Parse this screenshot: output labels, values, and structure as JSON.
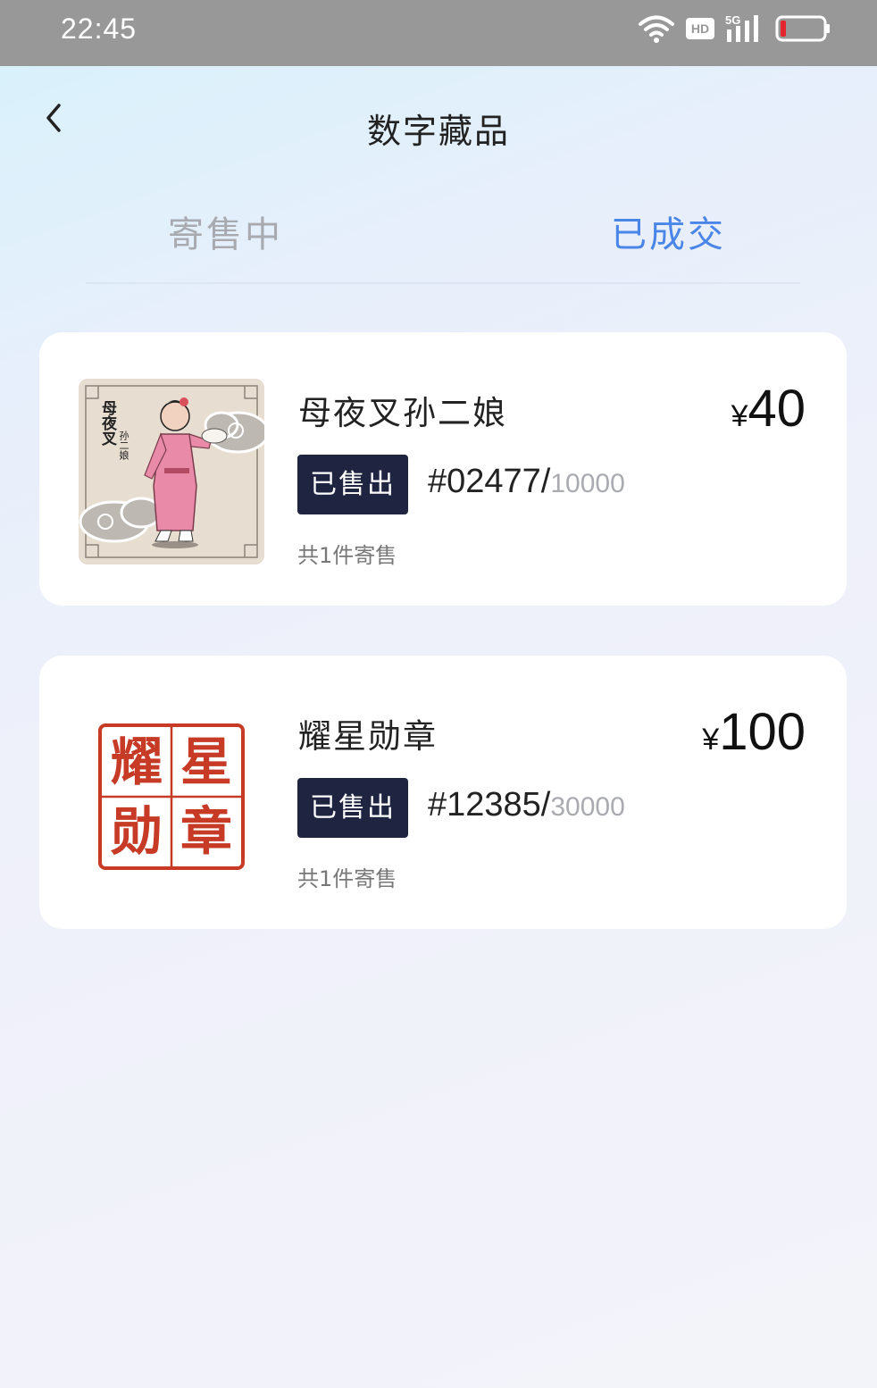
{
  "status_bar": {
    "time": "22:45",
    "icons": [
      "wifi-icon",
      "hd-icon",
      "5g-signal-icon",
      "battery-low-icon"
    ],
    "hd_label": "HD",
    "network_label": "5G"
  },
  "header": {
    "title": "数字藏品",
    "back_icon": "chevron-left-icon"
  },
  "tabs": [
    {
      "label": "寄售中",
      "active": false
    },
    {
      "label": "已成交",
      "active": true
    }
  ],
  "colors": {
    "active_tab": "#4a86e8",
    "inactive_tab": "#a8aab0",
    "badge_bg": "#1f2440",
    "seal_red": "#c63a26"
  },
  "items": [
    {
      "name": "母夜叉孙二娘",
      "price_symbol": "¥",
      "price": "40",
      "status": "已售出",
      "serial": "#02477/",
      "total": "10000",
      "count_text": "共1件寄售",
      "image": "sun-erniang-illustration",
      "image_text": "母夜叉",
      "image_subtext": "孙二娘"
    },
    {
      "name": "耀星勋章",
      "price_symbol": "¥",
      "price": "100",
      "status": "已售出",
      "serial": "#12385/",
      "total": "30000",
      "count_text": "共1件寄售",
      "image": "red-seal-stamp",
      "image_text": [
        "耀",
        "星",
        "勋",
        "章"
      ]
    }
  ]
}
